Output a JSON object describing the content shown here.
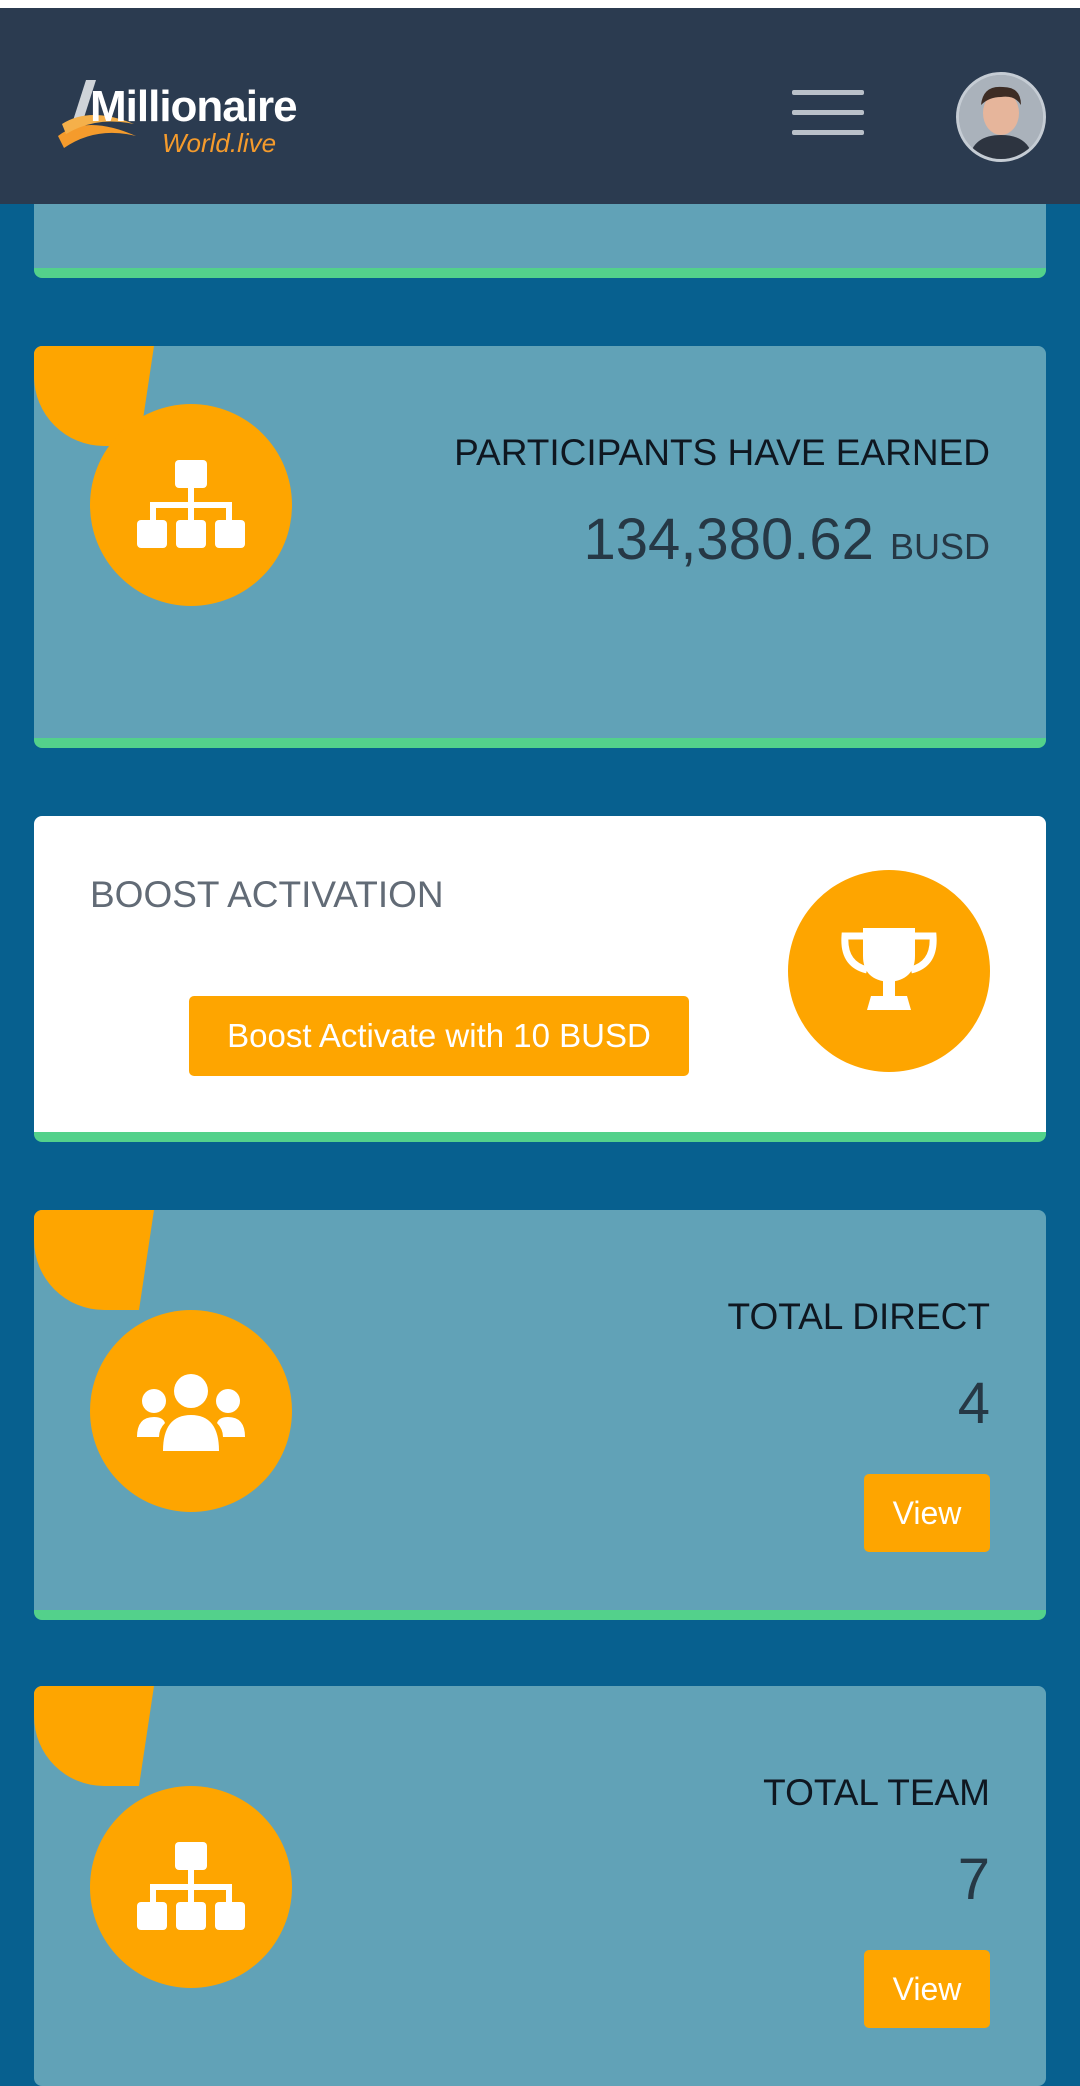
{
  "header": {
    "logo_main": "Millionaire",
    "logo_sub": "World.live",
    "menu_icon": "hamburger-menu-icon",
    "avatar_icon": "user-avatar"
  },
  "colors": {
    "page_bg": "#07608f",
    "header_bg": "#2b3b50",
    "card_bg": "#61a2b7",
    "accent_orange": "#fea500",
    "card_border_green": "#53d18b"
  },
  "cards": {
    "earned": {
      "title": "PARTICIPANTS HAVE EARNED",
      "value": "134,380.62",
      "unit": "BUSD",
      "icon": "sitemap-icon"
    },
    "boost": {
      "title": "BOOST ACTIVATION",
      "button_label": "Boost Activate with 10 BUSD",
      "icon": "trophy-icon"
    },
    "direct": {
      "title": "TOTAL DIRECT",
      "value": "4",
      "button_label": "View",
      "icon": "users-icon"
    },
    "team": {
      "title": "TOTAL TEAM",
      "value": "7",
      "button_label": "View",
      "icon": "sitemap-icon"
    }
  }
}
